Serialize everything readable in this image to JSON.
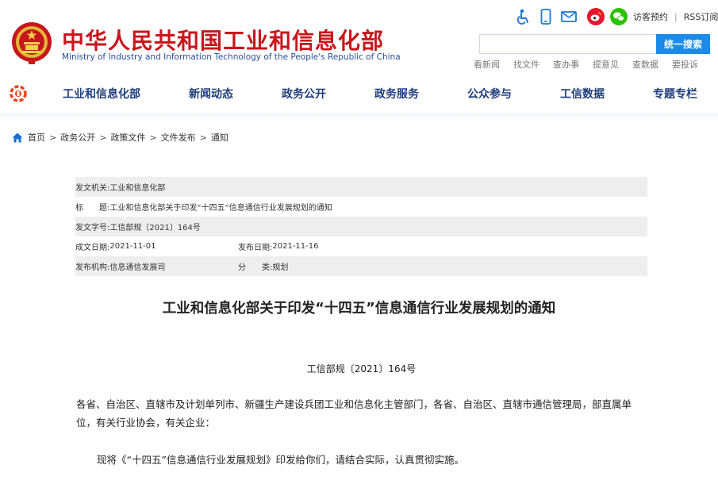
{
  "header": {
    "title": "中华人民共和国工业和信息化部",
    "subtitle": "Ministry of Industry and Information Technology of the People's Republic of China",
    "tools": {
      "icons": [
        "accessibility-icon",
        "mobile-icon",
        "mail-icon",
        "weibo-icon",
        "wechat-icon"
      ],
      "visitor_booking": "访客预约",
      "separator": "|",
      "rss": "RSS订阅"
    },
    "search": {
      "value": "",
      "button_label": "统一搜索"
    },
    "quick_links": [
      "看新闻",
      "找文件",
      "查办事",
      "提意见",
      "查数据",
      "要投诉"
    ]
  },
  "nav": {
    "items": [
      "工业和信息化部",
      "新闻动态",
      "政务公开",
      "政务服务",
      "公众参与",
      "工信数据",
      "专题专栏"
    ]
  },
  "breadcrumb": {
    "items": [
      "首页",
      "政务公开",
      "政策文件",
      "文件发布",
      "通知"
    ],
    "separator": ">"
  },
  "meta": {
    "issuer_label": "发文机关:",
    "issuer": "工业和信息化部",
    "title_label": "标　　题:",
    "title": "工业和信息化部关于印发“十四五”信息通信行业发展规划的通知",
    "doc_no_label": "发文字号:",
    "doc_no": "工信部规〔2021〕164号",
    "written_date_label": "成文日期:",
    "written_date": "2021-11-01",
    "publish_date_label": "发布日期:",
    "publish_date": "2021-11-16",
    "org_label": "发布机构:",
    "org": "信息通信发展司",
    "category_label": "分　　类:",
    "category": "规划"
  },
  "document": {
    "title": "工业和信息化部关于印发“十四五”信息通信行业发展规划的通知",
    "number": "工信部规〔2021〕164号",
    "addressees": "各省、自治区、直辖市及计划单列市、新疆生产建设兵团工业和信息化主管部门，各省、自治区、直辖市通信管理局，部直属单位，有关行业协会，有关企业：",
    "body": "现将《“十四五”信息通信行业发展规划》印发给你们，请结合实际，认真贯彻实施。"
  },
  "colors": {
    "brand_red": "#c8161d",
    "nav_blue": "#1f3d7a",
    "search_button": "#1a8be8",
    "meta_shade": "#eeeeee"
  }
}
